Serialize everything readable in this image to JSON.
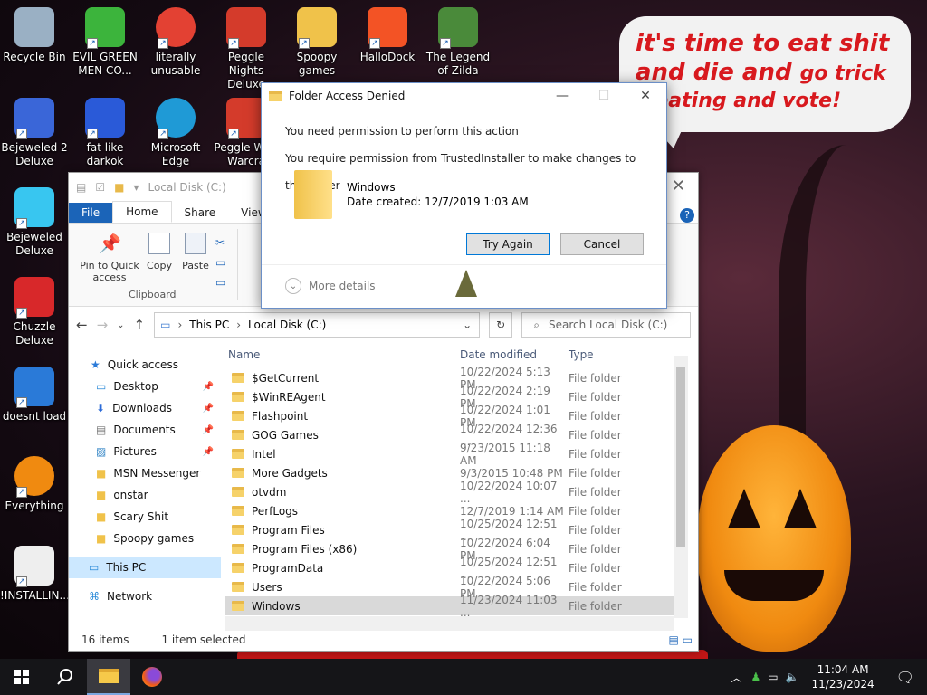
{
  "desktop": {
    "icons": [
      {
        "label": "Recycle Bin",
        "icon": "recycle-bin-icon",
        "color": "#9ab0c4"
      },
      {
        "label": "EVIL GREEN MEN CO...",
        "icon": "green-men-icon",
        "color": "#3cb43c"
      },
      {
        "label": "literally unusable",
        "icon": "chrome-icon",
        "color": "#e34133"
      },
      {
        "label": "Peggle Nights Deluxe",
        "icon": "peggle-icon",
        "color": "#d43b2b"
      },
      {
        "label": "Spoopy games",
        "icon": "folder-icon",
        "color": "#f0c24a"
      },
      {
        "label": "HalloDock",
        "icon": "windows-logo-icon",
        "color": "#f35325"
      },
      {
        "label": "The Legend of Zilda",
        "icon": "zilda-icon",
        "color": "#4a8a3a"
      },
      {
        "label": "Bejeweled 2 Deluxe",
        "icon": "bejeweled2-icon",
        "color": "#3a66d8"
      },
      {
        "label": "fat like darkok",
        "icon": "mpl-icon",
        "color": "#2a5ad8"
      },
      {
        "label": "Microsoft Edge",
        "icon": "edge-icon",
        "color": "#1f9ad6"
      },
      {
        "label": "Peggle W of Warcra",
        "icon": "peggle-warcraft-icon",
        "color": "#d43b2b"
      },
      {
        "label": "Bejeweled Deluxe",
        "icon": "bejeweled-icon",
        "color": "#38c6f0"
      },
      {
        "label": "Chuzzle Deluxe",
        "icon": "chuzzle-icon",
        "color": "#d8282a"
      },
      {
        "label": "doesnt load",
        "icon": "thunderbird-icon",
        "color": "#2a7ad8"
      },
      {
        "label": "Everything",
        "icon": "everything-search-icon",
        "color": "#f08a10"
      },
      {
        "label": "!INSTALLIN...",
        "icon": "text-file-icon",
        "color": "#eeeeee"
      }
    ],
    "bubble": {
      "line1": "it's time to eat shit",
      "line2a": "and die and",
      "line2b": "go trick",
      "line3": "treating and vote!"
    }
  },
  "explorer": {
    "title": "Local Disk (C:)",
    "tabs": [
      "File",
      "Home",
      "Share",
      "View"
    ],
    "ribbon": {
      "pin_label": "Pin to Quick access",
      "copy_label": "Copy",
      "paste_label": "Paste",
      "group_label": "Clipboard"
    },
    "address": {
      "part1": "This PC",
      "part2": "Local Disk (C:)"
    },
    "search_placeholder": "Search Local Disk (C:)",
    "nav": {
      "quick_access": "Quick access",
      "items": [
        "Desktop",
        "Downloads",
        "Documents",
        "Pictures",
        "MSN Messenger",
        "onstar",
        "Scary Shit",
        "Spoopy games"
      ],
      "this_pc": "This PC",
      "network": "Network"
    },
    "columns": {
      "name": "Name",
      "date": "Date modified",
      "type": "Type"
    },
    "files": [
      {
        "name": "$GetCurrent",
        "date": "10/22/2024 5:13 PM",
        "type": "File folder"
      },
      {
        "name": "$WinREAgent",
        "date": "10/22/2024 2:19 PM",
        "type": "File folder"
      },
      {
        "name": "Flashpoint",
        "date": "10/22/2024 1:01 PM",
        "type": "File folder"
      },
      {
        "name": "GOG Games",
        "date": "10/22/2024 12:36 ...",
        "type": "File folder"
      },
      {
        "name": "Intel",
        "date": "9/23/2015 11:18 AM",
        "type": "File folder"
      },
      {
        "name": "More Gadgets",
        "date": "9/3/2015 10:48 PM",
        "type": "File folder"
      },
      {
        "name": "otvdm",
        "date": "10/22/2024 10:07 ...",
        "type": "File folder"
      },
      {
        "name": "PerfLogs",
        "date": "12/7/2019 1:14 AM",
        "type": "File folder"
      },
      {
        "name": "Program Files",
        "date": "10/25/2024 12:51 ...",
        "type": "File folder"
      },
      {
        "name": "Program Files (x86)",
        "date": "10/22/2024 6:04 PM",
        "type": "File folder"
      },
      {
        "name": "ProgramData",
        "date": "10/25/2024 12:51 ...",
        "type": "File folder"
      },
      {
        "name": "Users",
        "date": "10/22/2024 5:06 PM",
        "type": "File folder"
      },
      {
        "name": "Windows",
        "date": "11/23/2024 11:03 ...",
        "type": "File folder"
      }
    ],
    "status": {
      "count": "16 items",
      "selected": "1 item selected"
    }
  },
  "dialog": {
    "title": "Folder Access Denied",
    "line1": "You need permission to perform this action",
    "line2": "You require permission from TrustedInstaller to make changes to this folder",
    "file_name": "Windows",
    "file_date": "Date created: 12/7/2019 1:03 AM",
    "try_again": "Try Again",
    "cancel": "Cancel",
    "more_details": "More details"
  },
  "taskbar": {
    "time": "11:04 AM",
    "date": "11/23/2024"
  }
}
